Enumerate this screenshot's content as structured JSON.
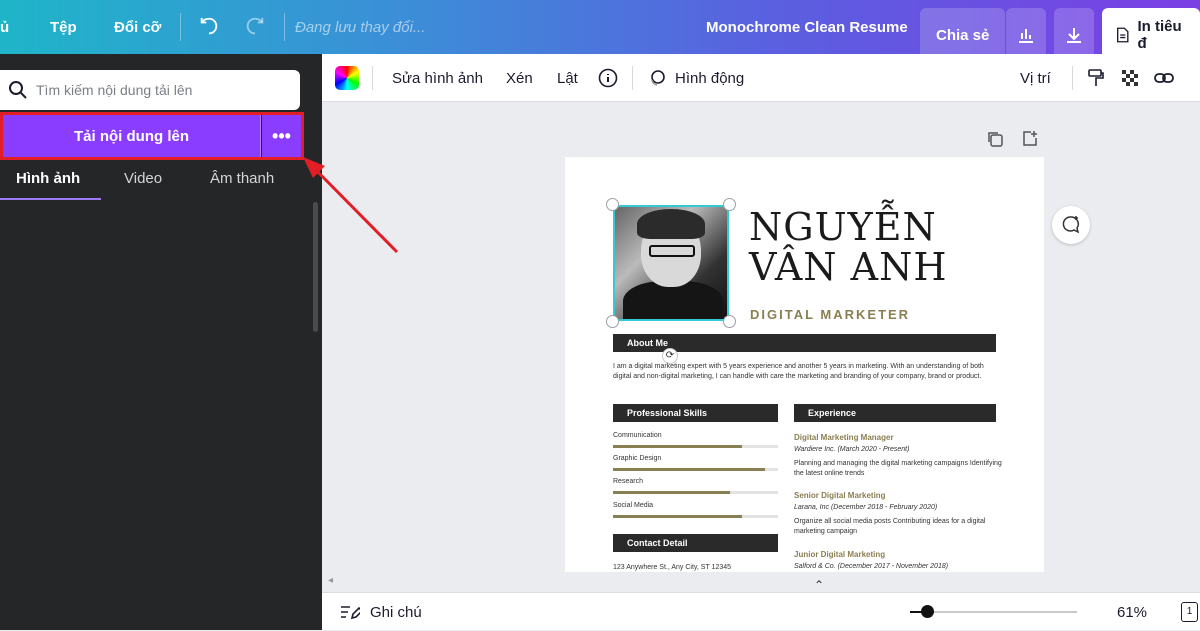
{
  "topbar": {
    "home_label": "ủ",
    "file_label": "Tệp",
    "resize_label": "Đổi cỡ",
    "saving_status": "Đang lưu thay đổi...",
    "doc_title": "Monochrome Clean Resume",
    "share_label": "Chia sẻ",
    "print_label": "In tiêu đ"
  },
  "left_panel": {
    "search_placeholder": "Tìm kiếm nội dung tải lên",
    "upload_label": "Tải nội dung lên",
    "more_label": "•••",
    "tabs": [
      "Hình ảnh",
      "Video",
      "Âm thanh"
    ]
  },
  "toolbar": {
    "edit_image": "Sửa hình ảnh",
    "crop": "Xén",
    "flip": "Lật",
    "animate": "Hình động",
    "position": "Vị trí"
  },
  "resume": {
    "name_line1": "NGUYỄN",
    "name_line2": "VÂN ANH",
    "role": "DIGITAL MARKETER",
    "about_header": "About Me",
    "about_text": "I am a digital marketing expert with 5 years experience and another 5 years in marketing. With an understanding of both digital and non-digital marketing, I can handle with care the marketing and branding of your company, brand or product.",
    "skills_header": "Professional Skills",
    "skills": [
      {
        "label": "Communication",
        "level": 0.78
      },
      {
        "label": "Graphic Design",
        "level": 0.92
      },
      {
        "label": "Research",
        "level": 0.71
      },
      {
        "label": "Social Media",
        "level": 0.78
      }
    ],
    "contact_header": "Contact Detail",
    "contact_address": "123 Anywhere St., Any City, ST 12345",
    "experience_header": "Experience",
    "experience": [
      {
        "title": "Digital Marketing Manager",
        "company": "Wardiere Inc. (March 2020 - Present)",
        "desc": "Planning and managing the digital marketing campaigns Identifying the latest online trends"
      },
      {
        "title": "Senior Digital Marketing",
        "company": "Larana, Inc (December 2018 - February 2020)",
        "desc": "Organize all social media posts Contributing ideas for a digital marketing campaign"
      },
      {
        "title": "Junior Digital Marketing",
        "company": "Salford & Co. (December 2017 - November 2018)",
        "desc": ""
      }
    ]
  },
  "bottom": {
    "notes_label": "Ghi chú",
    "zoom": "61%",
    "page_number": "1"
  },
  "colors": {
    "accent_purple": "#8b3dff",
    "highlight_red": "#e11d26",
    "gold": "#8a7f52"
  }
}
